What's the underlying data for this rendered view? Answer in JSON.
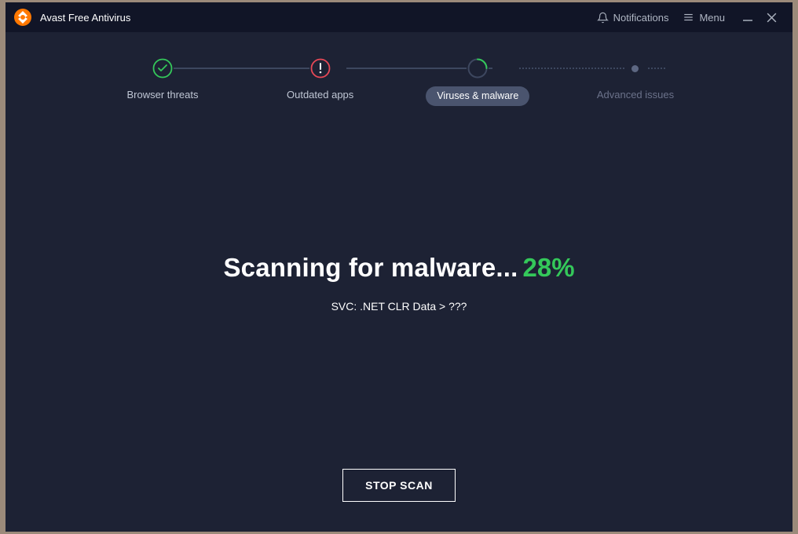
{
  "titlebar": {
    "app_title": "Avast Free Antivirus",
    "notifications_label": "Notifications",
    "menu_label": "Menu"
  },
  "steps": {
    "browser_threats": "Browser threats",
    "outdated_apps": "Outdated apps",
    "viruses_malware": "Viruses & malware",
    "advanced_issues": "Advanced issues"
  },
  "scan": {
    "headline": "Scanning for malware...",
    "percent": "28%",
    "detail": "SVC: .NET CLR Data > ???"
  },
  "actions": {
    "stop_scan": "STOP SCAN"
  },
  "colors": {
    "accent_green": "#34c85a",
    "accent_orange": "#ff7800",
    "warn_red": "#e74856"
  }
}
